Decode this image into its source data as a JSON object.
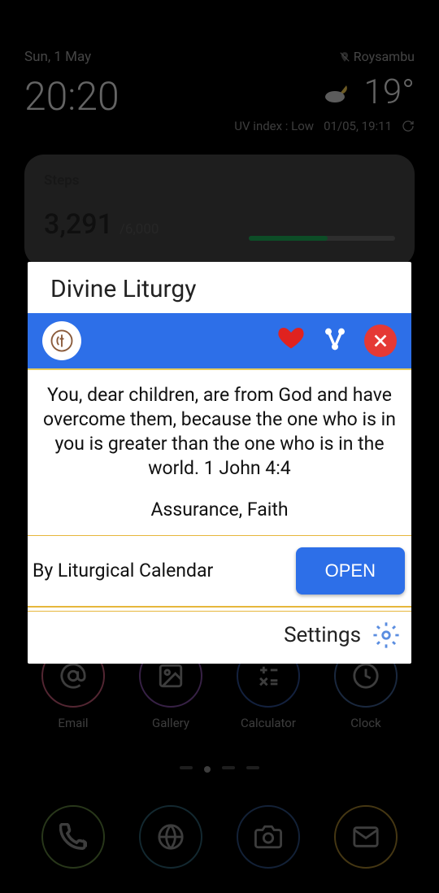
{
  "status": {
    "date": "Sun, 1 May",
    "time": "20:20",
    "location": "Roysambu",
    "temperature": "19°",
    "uv_label": "UV index : Low",
    "updated": "01/05, 19:11"
  },
  "steps": {
    "title": "Steps",
    "count": "3,291",
    "goal": "/6,000",
    "percent": "54%"
  },
  "dock1": [
    {
      "label": "Email",
      "ring": "#b85570"
    },
    {
      "label": "Gallery",
      "ring": "#7a4a9a"
    },
    {
      "label": "Calculator",
      "ring": "#2c4a8a"
    },
    {
      "label": "Clock",
      "ring": "#3a5a8a"
    }
  ],
  "dock2_rings": [
    "#5a7a3a",
    "#2a5a6a",
    "#2a4a7a",
    "#9a7a2a"
  ],
  "popup": {
    "title": "Divine Liturgy",
    "verse": "You, dear children, are from God and have overcome them, because the one who is in you is greater than the one who is in the world. 1 John 4:4",
    "themes": "Assurance, Faith",
    "by": "By Liturgical Calendar",
    "open": "OPEN",
    "settings": "Settings"
  }
}
